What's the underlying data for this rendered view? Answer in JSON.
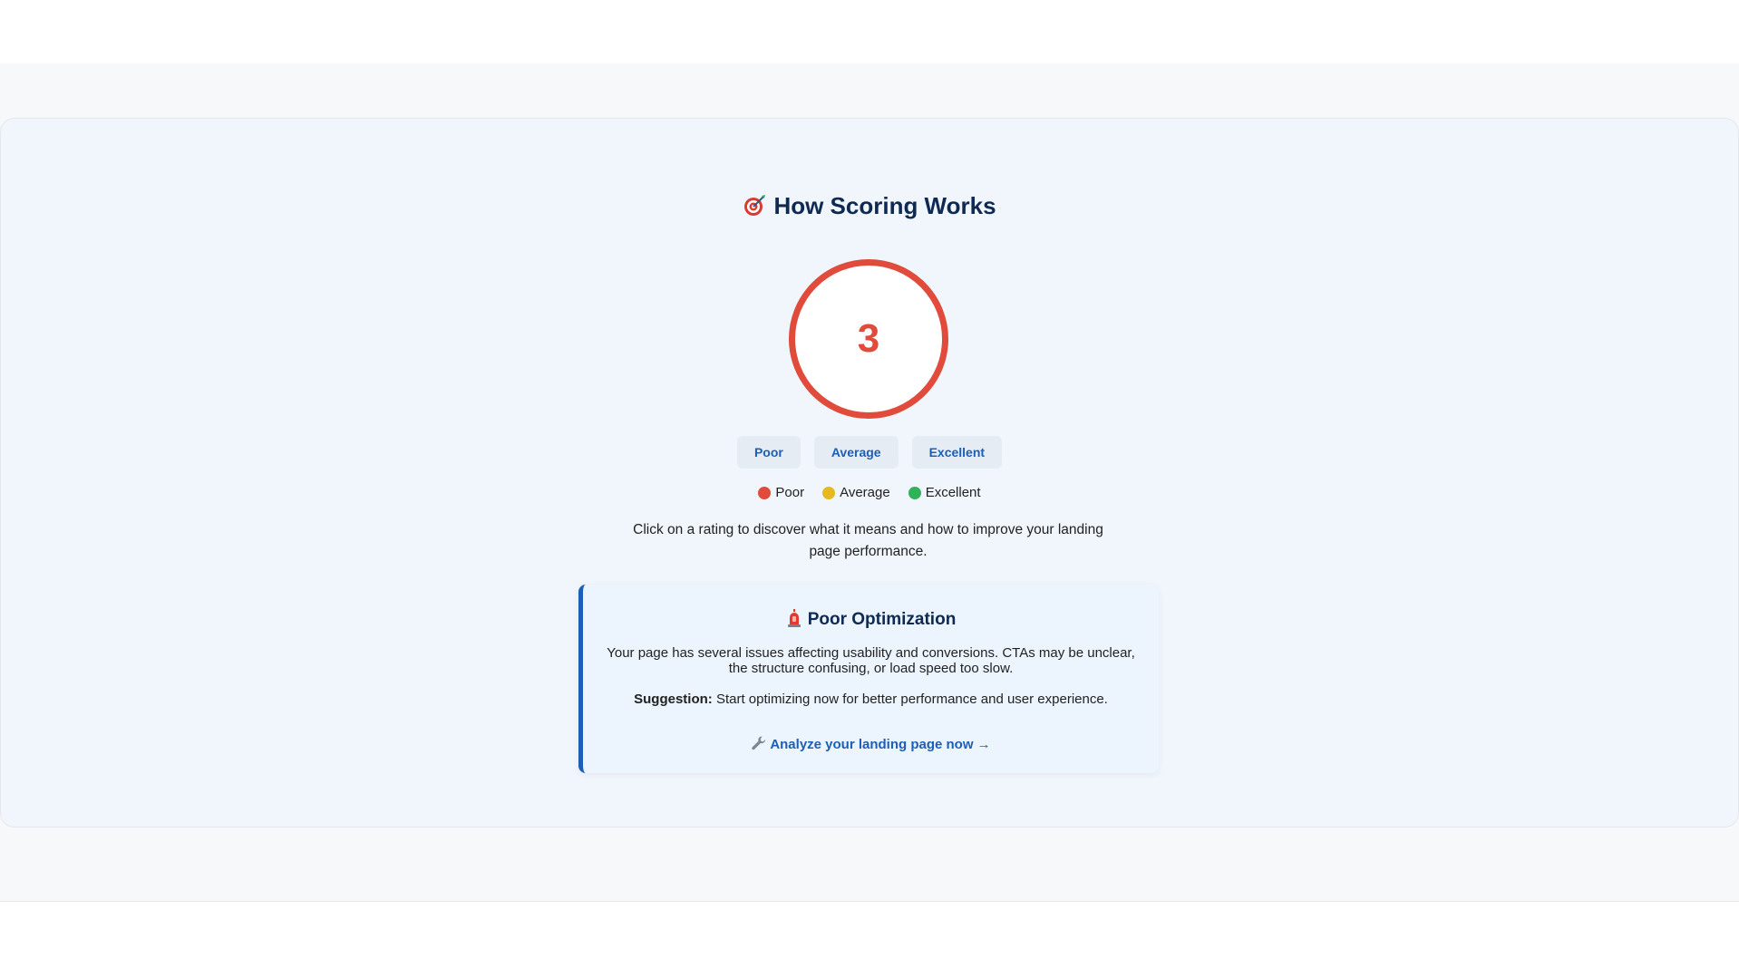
{
  "section": {
    "title": "How Scoring Works",
    "title_icon": "target-icon"
  },
  "score": {
    "value": "3",
    "ring_color": "#e04b3c"
  },
  "rating_buttons": [
    {
      "label": "Poor"
    },
    {
      "label": "Average"
    },
    {
      "label": "Excellent"
    }
  ],
  "legend": [
    {
      "label": "Poor",
      "color": "#e04b3c"
    },
    {
      "label": "Average",
      "color": "#e6b91f"
    },
    {
      "label": "Excellent",
      "color": "#2fb35a"
    }
  ],
  "instructions": "Click on a rating to discover what it means and how to improve your landing page performance.",
  "detail": {
    "title_icon": "siren-icon",
    "title": "Poor Optimization",
    "description": "Your page has several issues affecting usability and conversions. CTAs may be unclear, the structure confusing, or load speed too slow.",
    "suggestion_label": "Suggestion:",
    "suggestion_text": " Start optimizing now for better performance and user experience.",
    "cta_icon": "wrench-icon",
    "cta_label": "Analyze your landing page now →"
  },
  "colors": {
    "accent": "#1b5fb8",
    "heading": "#0f2a52",
    "card_bg": "#f1f6fc"
  }
}
